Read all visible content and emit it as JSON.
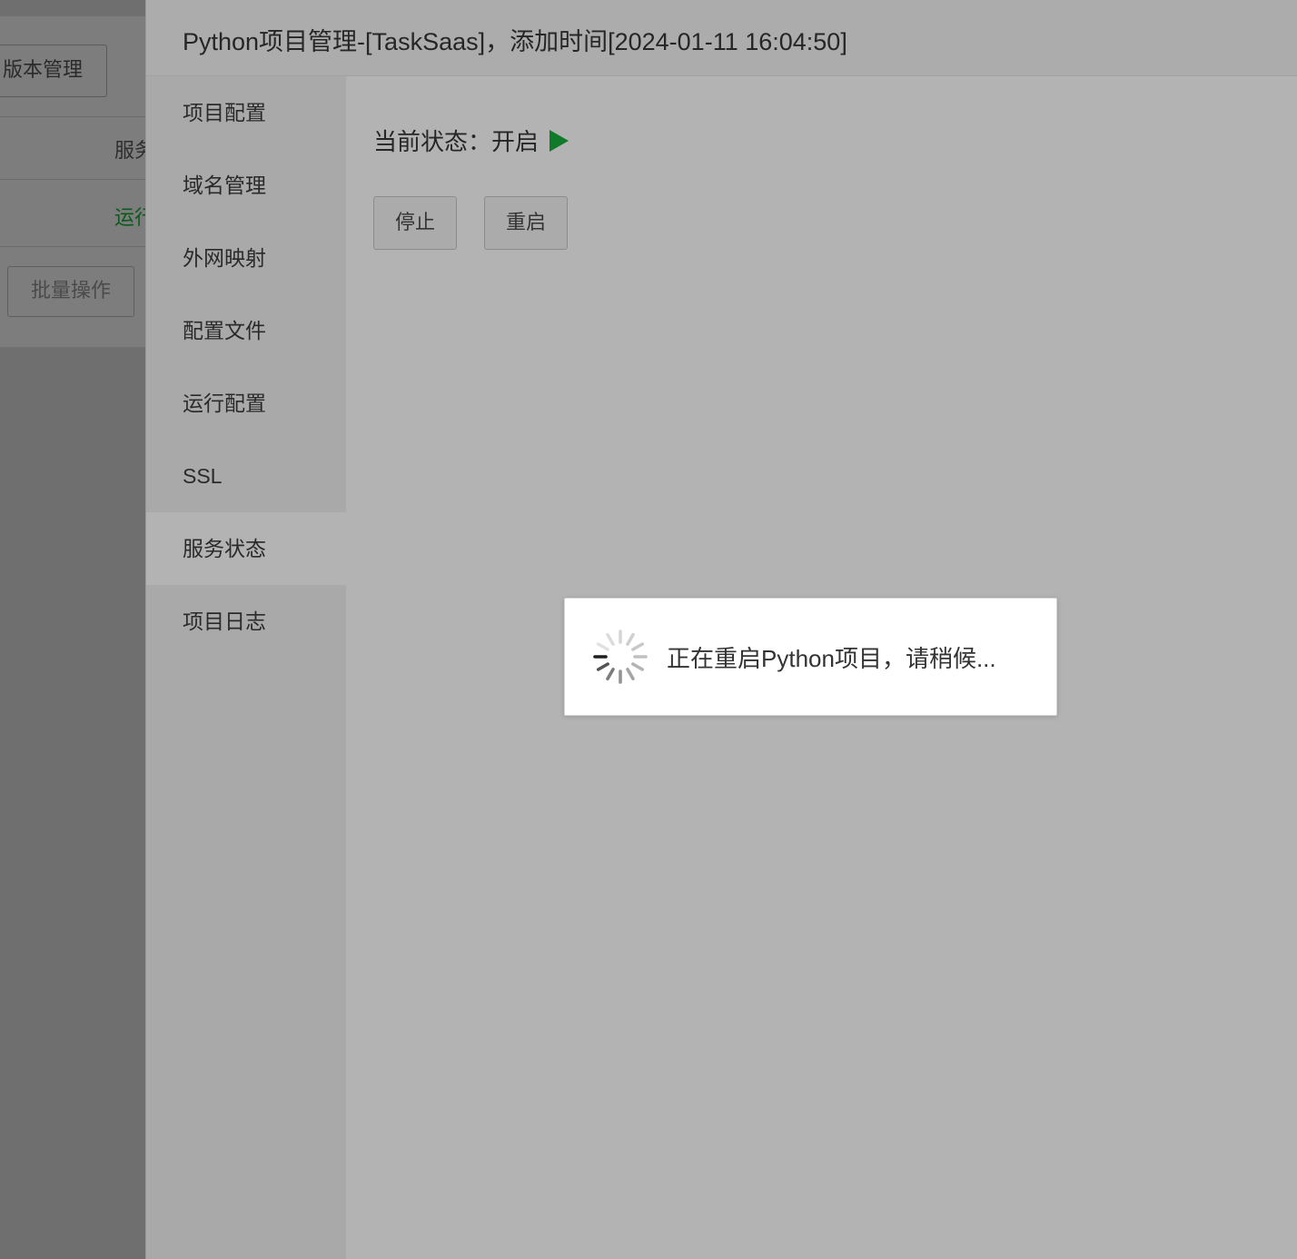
{
  "background_page": {
    "version_button_label": "版本管理",
    "table_header_cell": "服务",
    "table_status_cell": "运行",
    "status_color": "#0b5a1c",
    "batch_button_label": "批量操作"
  },
  "modal": {
    "title": "Python项目管理-[TaskSaas]，添加时间[2024-01-11 16:04:50]",
    "sidebar": {
      "items": [
        {
          "label": "项目配置",
          "active": false
        },
        {
          "label": "域名管理",
          "active": false
        },
        {
          "label": "外网映射",
          "active": false
        },
        {
          "label": "配置文件",
          "active": false
        },
        {
          "label": "运行配置",
          "active": false
        },
        {
          "label": "SSL",
          "active": false
        },
        {
          "label": "服务状态",
          "active": true
        },
        {
          "label": "项目日志",
          "active": false
        }
      ]
    },
    "service_status": {
      "label": "当前状态：",
      "value": "开启",
      "icon": "play-icon",
      "icon_color": "#0f7a2a",
      "stop_button_label": "停止",
      "restart_button_label": "重启"
    }
  },
  "loading_toast": {
    "icon": "spinner-icon",
    "message": "正在重启Python项目，请稍候..."
  }
}
